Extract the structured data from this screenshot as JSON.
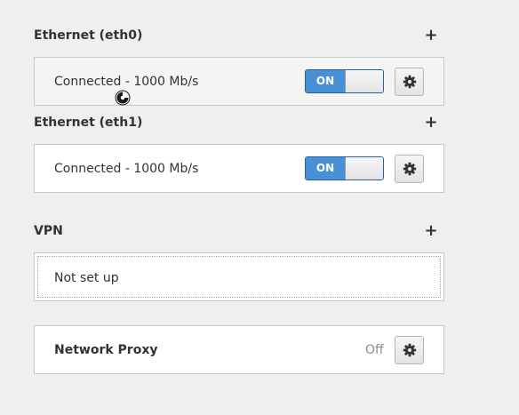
{
  "sections": {
    "eth0": {
      "title": "Ethernet (eth0)",
      "add": "+",
      "status": "Connected - 1000 Mb/s",
      "switch_label": "ON",
      "switch_state": "on"
    },
    "eth1": {
      "title": "Ethernet (eth1)",
      "add": "+",
      "status": "Connected - 1000 Mb/s",
      "switch_label": "ON",
      "switch_state": "on"
    },
    "vpn": {
      "title": "VPN",
      "add": "+",
      "status": "Not set up"
    },
    "proxy": {
      "label": "Network Proxy",
      "state": "Off"
    }
  },
  "colors": {
    "switch_on": "#4a90d9",
    "background": "#efefee",
    "text": "#2e3436",
    "muted": "#8b8e8f"
  },
  "icons": {
    "settings": "gear-icon",
    "add": "plus-icon",
    "pointer": "busy-cursor-icon"
  }
}
